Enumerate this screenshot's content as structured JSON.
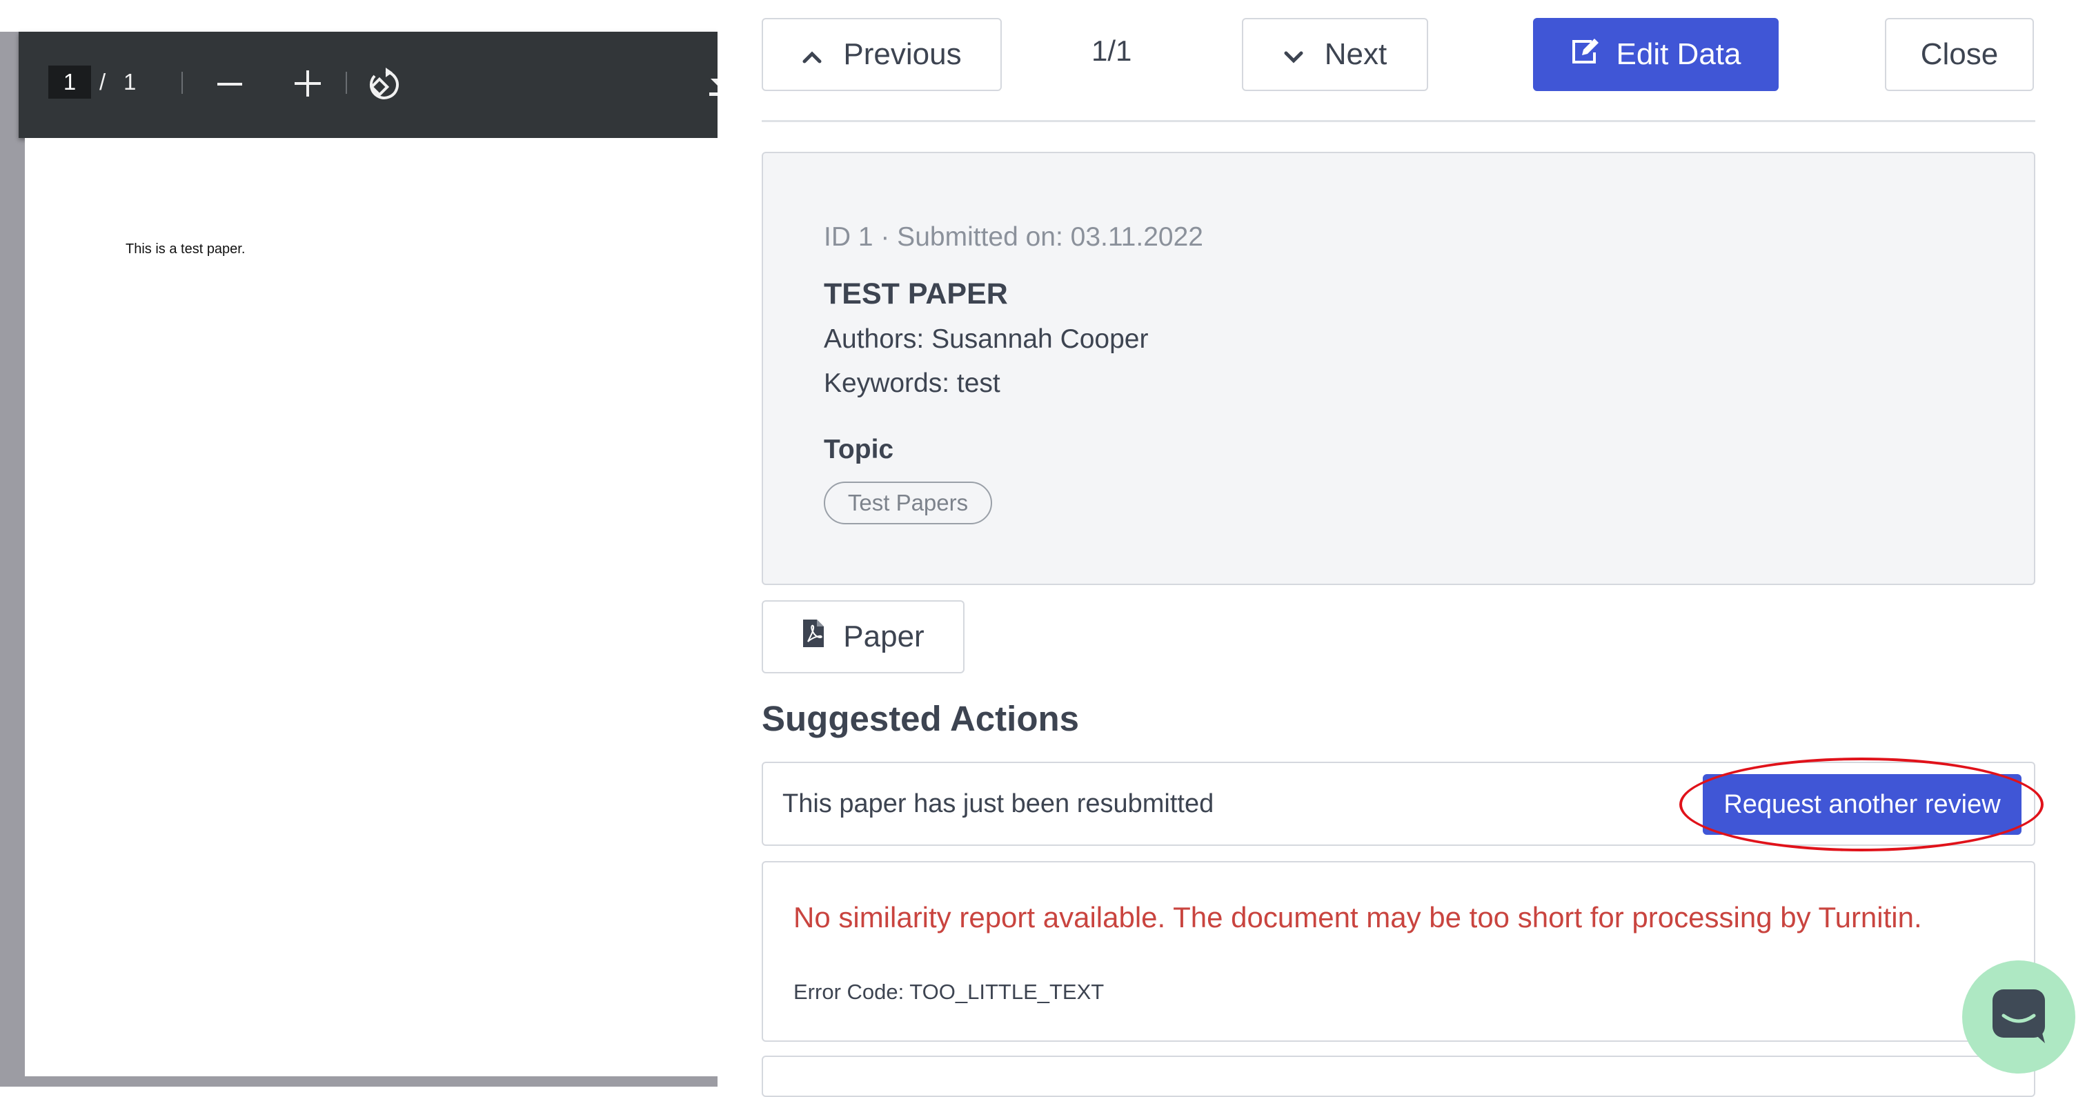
{
  "viewer": {
    "page_current": "1",
    "page_separator": "/",
    "page_total": "1",
    "page_text": "This is a test paper."
  },
  "navigation": {
    "previous_label": "Previous",
    "counter": "1/1",
    "next_label": "Next",
    "edit_label": "Edit Data",
    "close_label": "Close"
  },
  "paper": {
    "meta": "ID 1 · Submitted on: 03.11.2022",
    "title": "TEST PAPER",
    "authors": "Authors: Susannah Cooper",
    "keywords": "Keywords: test",
    "topic_heading": "Topic",
    "topic_tag": "Test Papers",
    "file_button_label": "Paper"
  },
  "suggested_actions": {
    "heading": "Suggested Actions",
    "message": "This paper has just been resubmitted",
    "action_label": "Request another review"
  },
  "similarity": {
    "error_message": "No similarity report available. The document may be too short for processing by Turnitin.",
    "error_code": "Error Code: TOO_LITTLE_TEXT"
  },
  "colors": {
    "primary": "#4056d6",
    "error_text": "#c9443f",
    "highlight": "#e0121a",
    "chat": "#aee8c3"
  },
  "icons": [
    "rotate-icon",
    "download-icon",
    "chevron-up-icon",
    "chevron-down-icon",
    "edit-icon",
    "pdf-file-icon",
    "chat-icon"
  ]
}
